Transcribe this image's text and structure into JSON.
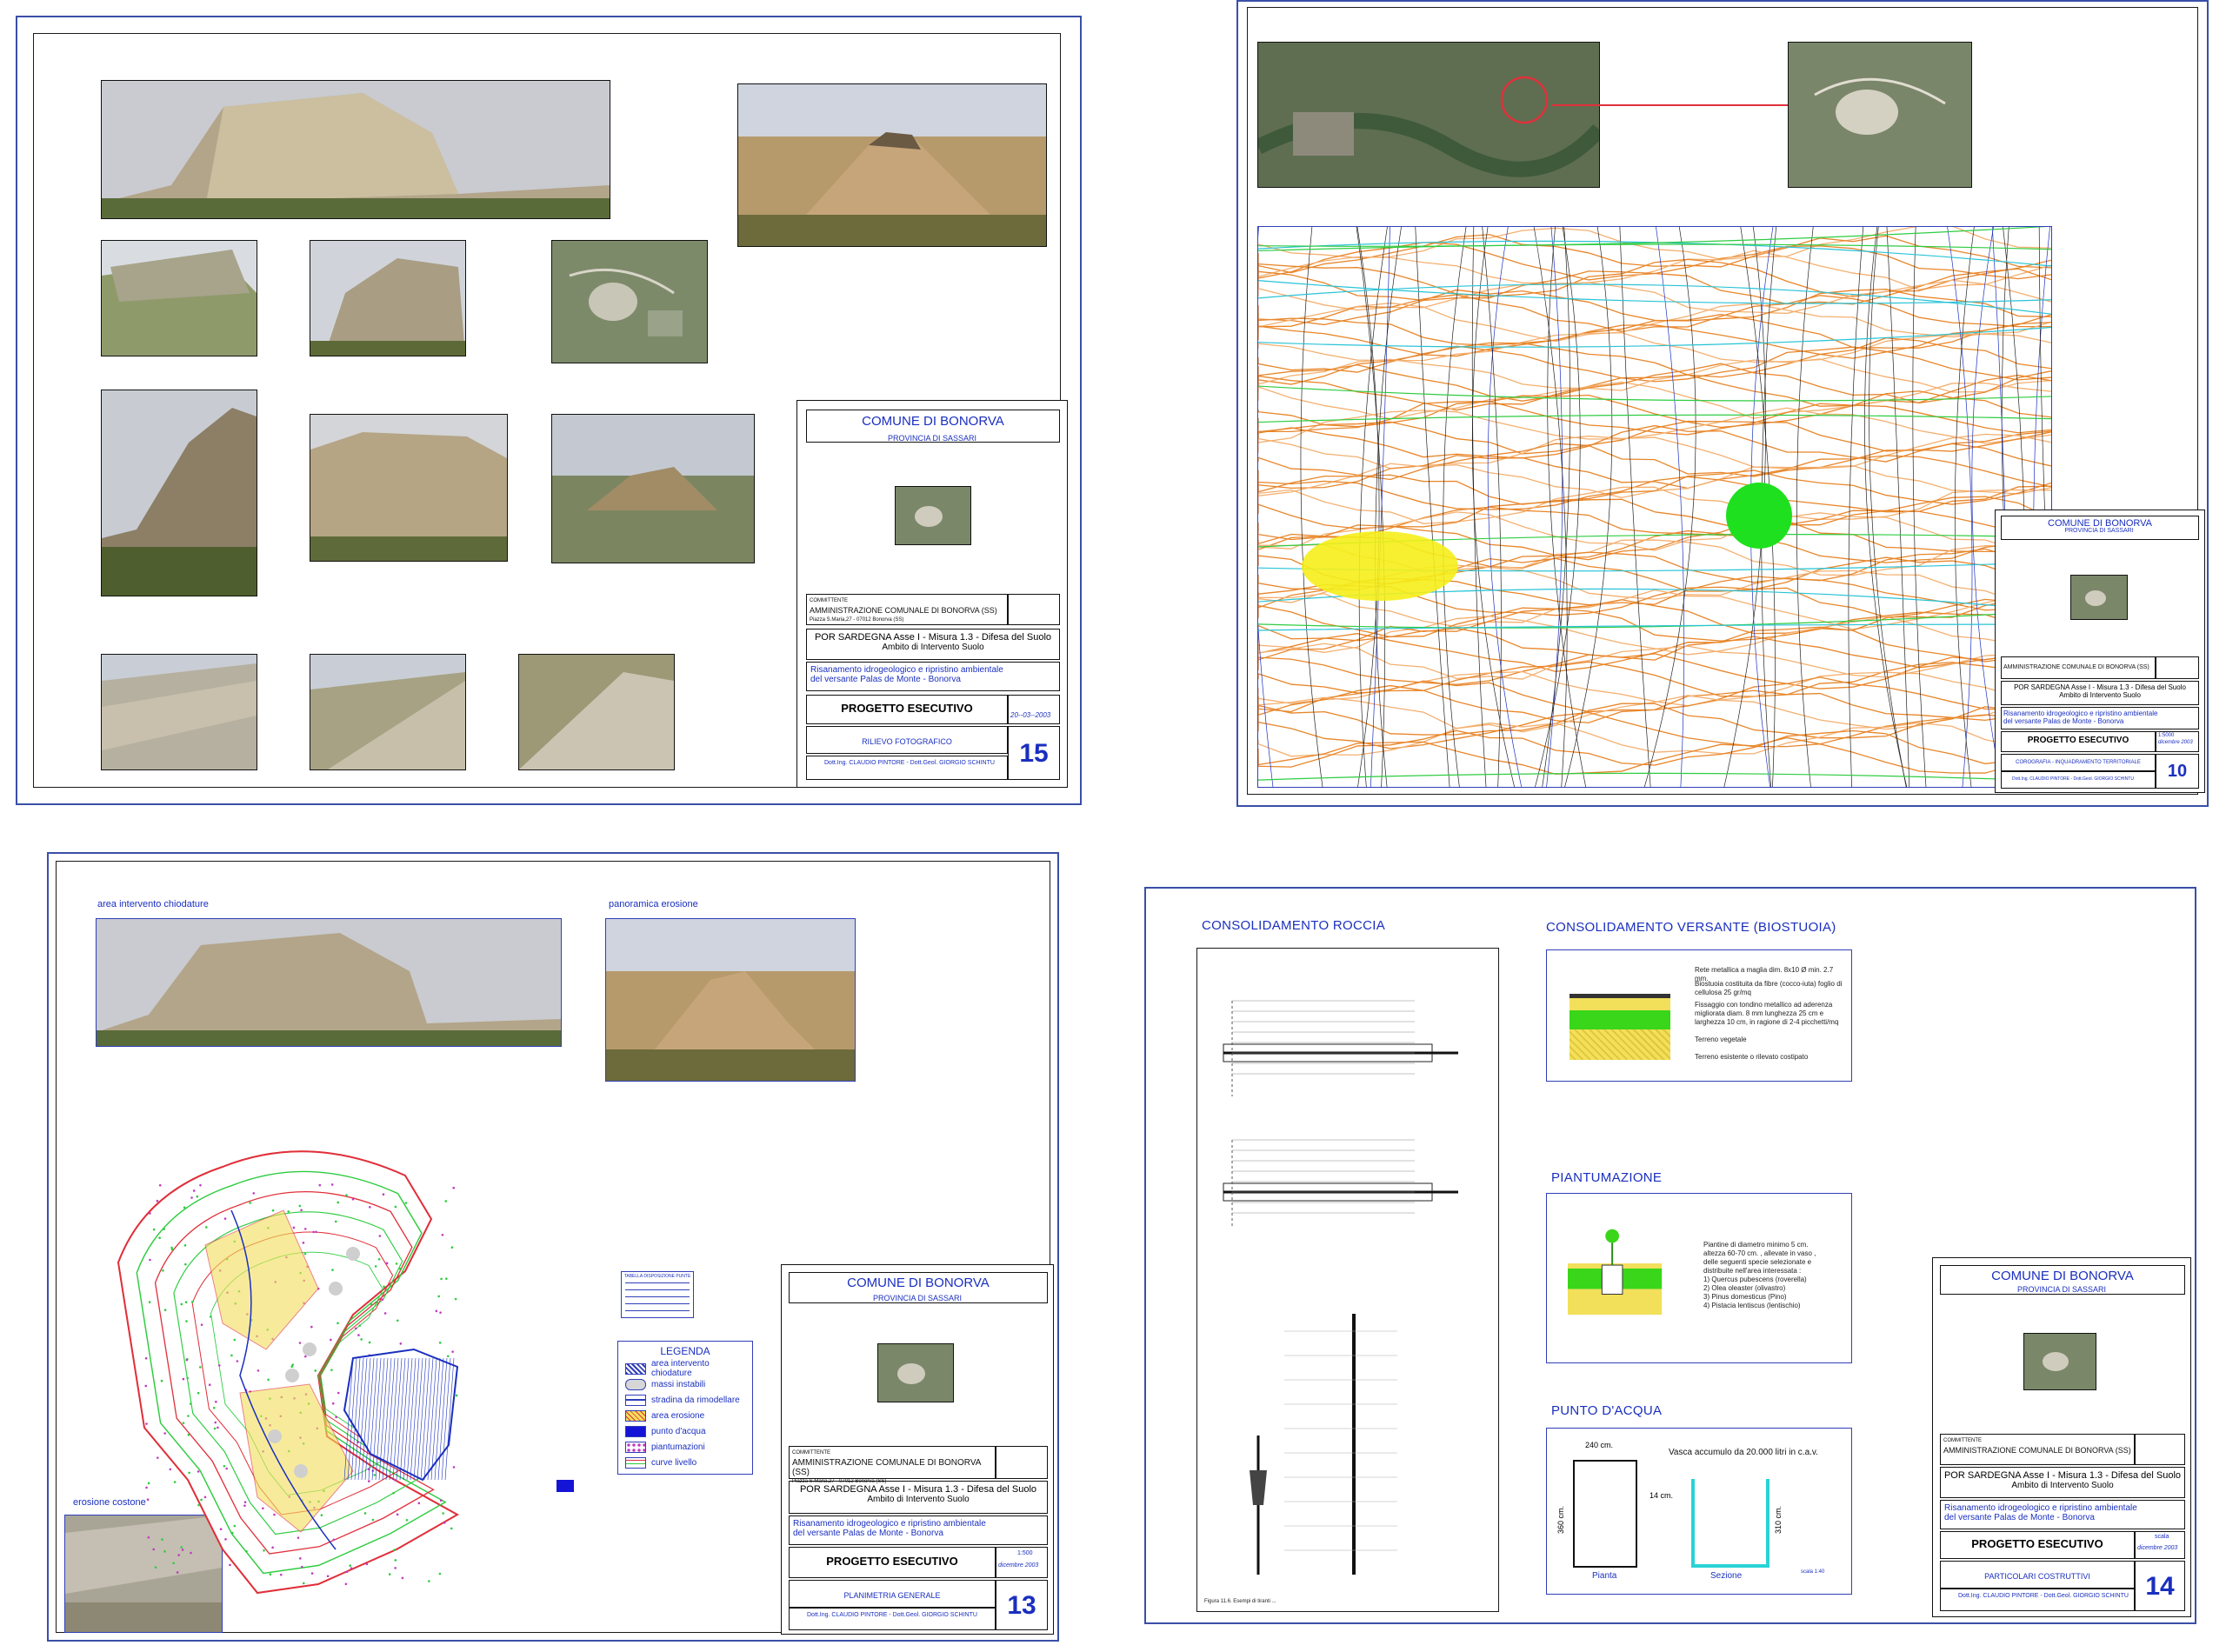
{
  "cartouche_common": {
    "comune": "COMUNE DI BONORVA",
    "provincia": "PROVINCIA DI SASSARI",
    "committente": "AMMINISTRAZIONE COMUNALE DI BONORVA (SS)",
    "committente_addr": "Piazza S.Maria,27 - 07012 Bonorva (SS)",
    "programma": "POR SARDEGNA Asse I - Misura 1.3 - Difesa del Suolo",
    "ambito": "Ambito di  Intervento Suolo",
    "titolo_1": "Risanamento idrogeologico e ripristino ambientale",
    "titolo_2": "del versante Palas de Monte - Bonorva",
    "fase": "PROGETTO ESECUTIVO",
    "progettisti": "Dott.Ing. CLAUDIO PINTORE - Dott.Geol. GIORGIO SCHINTU"
  },
  "sheet15": {
    "date": "20--03--2003",
    "tavola": "RILIEVO FOTOGRAFICO",
    "number": "15"
  },
  "sheet10": {
    "scale": "1:5000",
    "date": "dicembre 2003",
    "tavola": "COROGRAFIA - INQUADRAMENTO TERRITORIALE",
    "number": "10"
  },
  "sheet13": {
    "label_chiodature": "area intervento chiodature",
    "label_panoramica": "panoramica erosione",
    "label_erosione": "erosione costone",
    "legend_title": "LEGENDA",
    "legend_items": [
      "area intervento chiodature",
      "massi instabili",
      "stradina da rimodellare",
      "area erosione",
      "punto d'acqua",
      "piantumazioni",
      "curve livello"
    ],
    "scale": "1:500",
    "date": "dicembre 2003",
    "tavola": "PLANIMETRIA GENERALE",
    "number": "13"
  },
  "sheet14": {
    "h_roccia": "CONSOLIDAMENTO ROCCIA",
    "h_versante": "CONSOLIDAMENTO VERSANTE (BIOSTUOIA)",
    "h_piantumazione": "PIANTUMAZIONE",
    "h_punto": "PUNTO D'ACQUA",
    "versante_notes": [
      "Rete metallica a maglia dim. 8x10 Ø min. 2.7 mm.",
      "Biostuoia costituita da  fibre (cocco-iuta) foglio di cellulosa 25 gr/mq",
      "Fissaggio con tondino metallico ad aderenza migliorata diam. 8 mm lunghezza 25 cm e larghezza 10 cm, in ragione di 2-4 picchetti/mq",
      "Terreno vegetale",
      "Terreno esistente o rilevato costipato"
    ],
    "piantumazione_notes": [
      "Piantine di diametro minimo  5 cm.",
      "altezza 60-70 cm. , allevate in vaso ,",
      "delle seguenti specie selezionate e",
      "distribuite nell'area interessata :",
      "1) Quercus pubescens (roverella)",
      "2) Olea oleaster (olivastro)",
      "3) Pinus domesticus (Pino)",
      "4) Pistacia lentiscus (lentischio)"
    ],
    "vasca": "Vasca accumulo da 20.000 litri in c.a.v.",
    "dim_240": "240 cm.",
    "dim_360": "360 cm.",
    "dim_14": "14 cm.",
    "dim_310": "310 cm.",
    "pianta": "Pianta",
    "sezione": "Sezione",
    "scala": "scala 1:40",
    "fig_caption": "Figura 11.6. Esempi di tiranti ...",
    "scale": "scala",
    "date": "dicembre 2003",
    "tavola": "PARTICOLARI COSTRUTTIVI",
    "number": "14"
  },
  "colors": {
    "sheet_border": "#3a4fa8",
    "cartouche_text": "#1a2fbf",
    "contour_orange": "#e8862a",
    "contour_green": "#2ecc40",
    "erosion_red": "#e0303a",
    "grass": "#39d61a",
    "soil_yellow": "#f2df5a"
  }
}
